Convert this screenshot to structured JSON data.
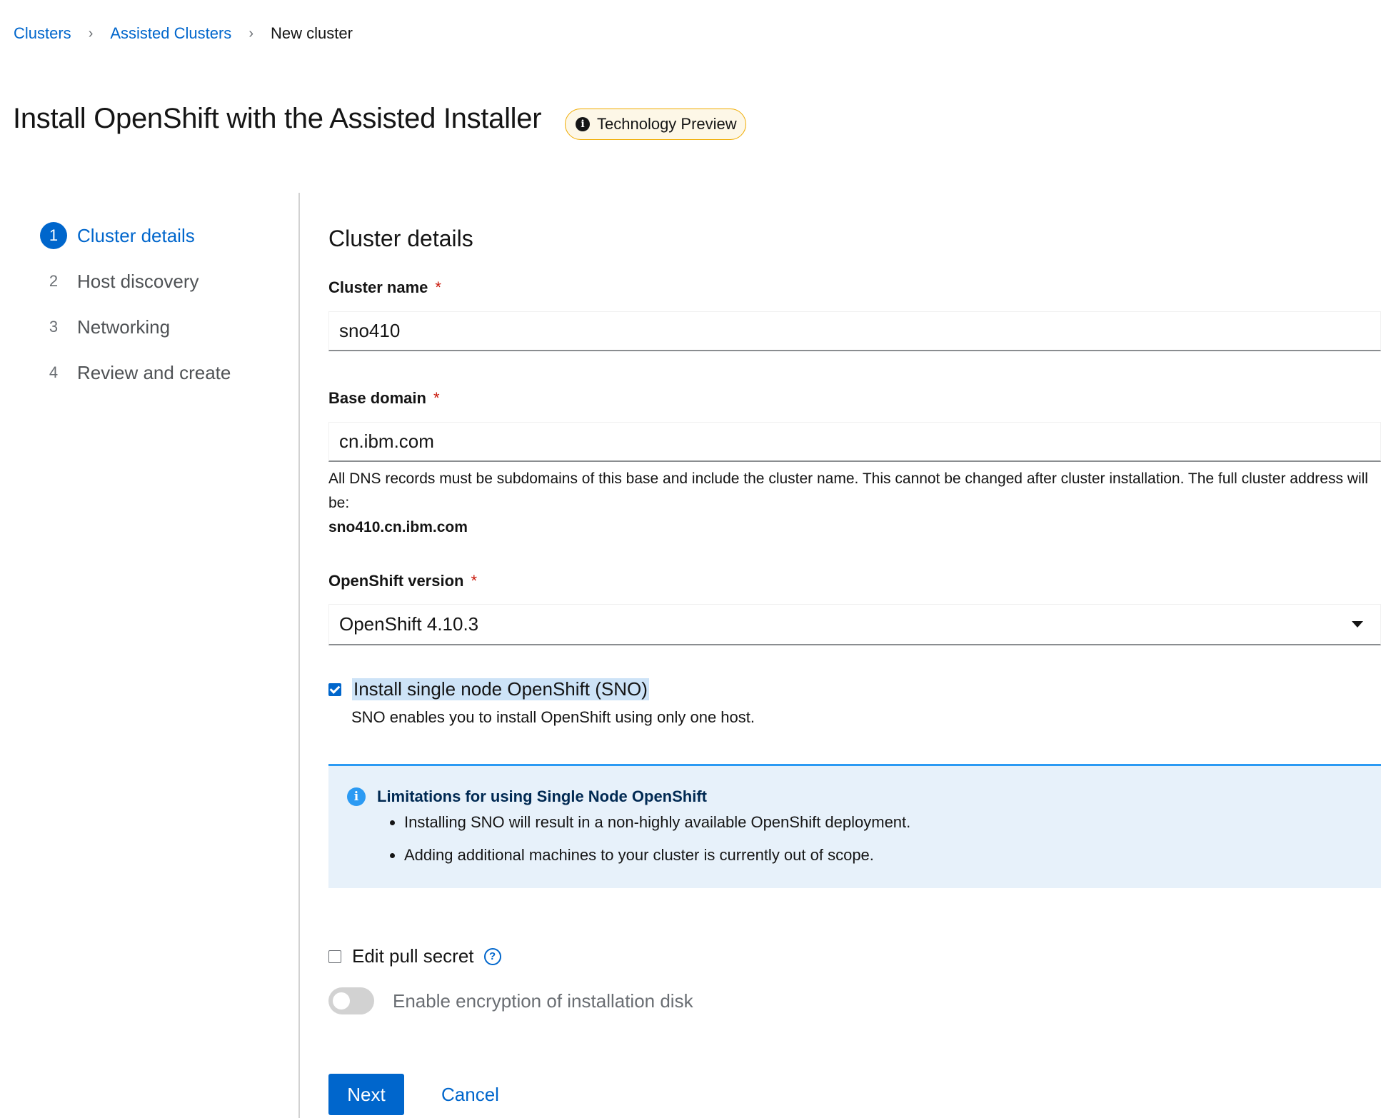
{
  "breadcrumb": {
    "items": [
      "Clusters",
      "Assisted Clusters"
    ],
    "current": "New cluster"
  },
  "header": {
    "title": "Install OpenShift with the Assisted Installer",
    "badge": "Technology Preview"
  },
  "wizard": {
    "steps": [
      {
        "num": "1",
        "label": "Cluster details",
        "active": true
      },
      {
        "num": "2",
        "label": "Host discovery",
        "active": false
      },
      {
        "num": "3",
        "label": "Networking",
        "active": false
      },
      {
        "num": "4",
        "label": "Review and create",
        "active": false
      }
    ]
  },
  "form": {
    "section_title": "Cluster details",
    "cluster_name": {
      "label": "Cluster name",
      "value": "sno410"
    },
    "base_domain": {
      "label": "Base domain",
      "value": "cn.ibm.com",
      "helper": "All DNS records must be subdomains of this base and include the cluster name. This cannot be changed after cluster installation. The full cluster address will be:",
      "full_address": "sno410.cn.ibm.com"
    },
    "openshift_version": {
      "label": "OpenShift version",
      "value": "OpenShift 4.10.3"
    },
    "required_marker": "*",
    "sno": {
      "label": "Install single node OpenShift (SNO)",
      "checked": true,
      "description": "SNO enables you to install OpenShift using only one host."
    },
    "alert": {
      "title": "Limitations for using Single Node OpenShift",
      "items": [
        "Installing SNO will result in a non-highly available OpenShift deployment.",
        "Adding additional machines to your cluster is currently out of scope."
      ]
    },
    "pull_secret": {
      "label": "Edit pull secret",
      "checked": false
    },
    "encryption": {
      "label": "Enable encryption of installation disk",
      "enabled": false
    }
  },
  "footer": {
    "next_label": "Next",
    "cancel_label": "Cancel"
  },
  "colors": {
    "link": "#0066cc",
    "required": "#c9190b",
    "info": "#2b9af3",
    "badge_border": "#f0ab00"
  }
}
